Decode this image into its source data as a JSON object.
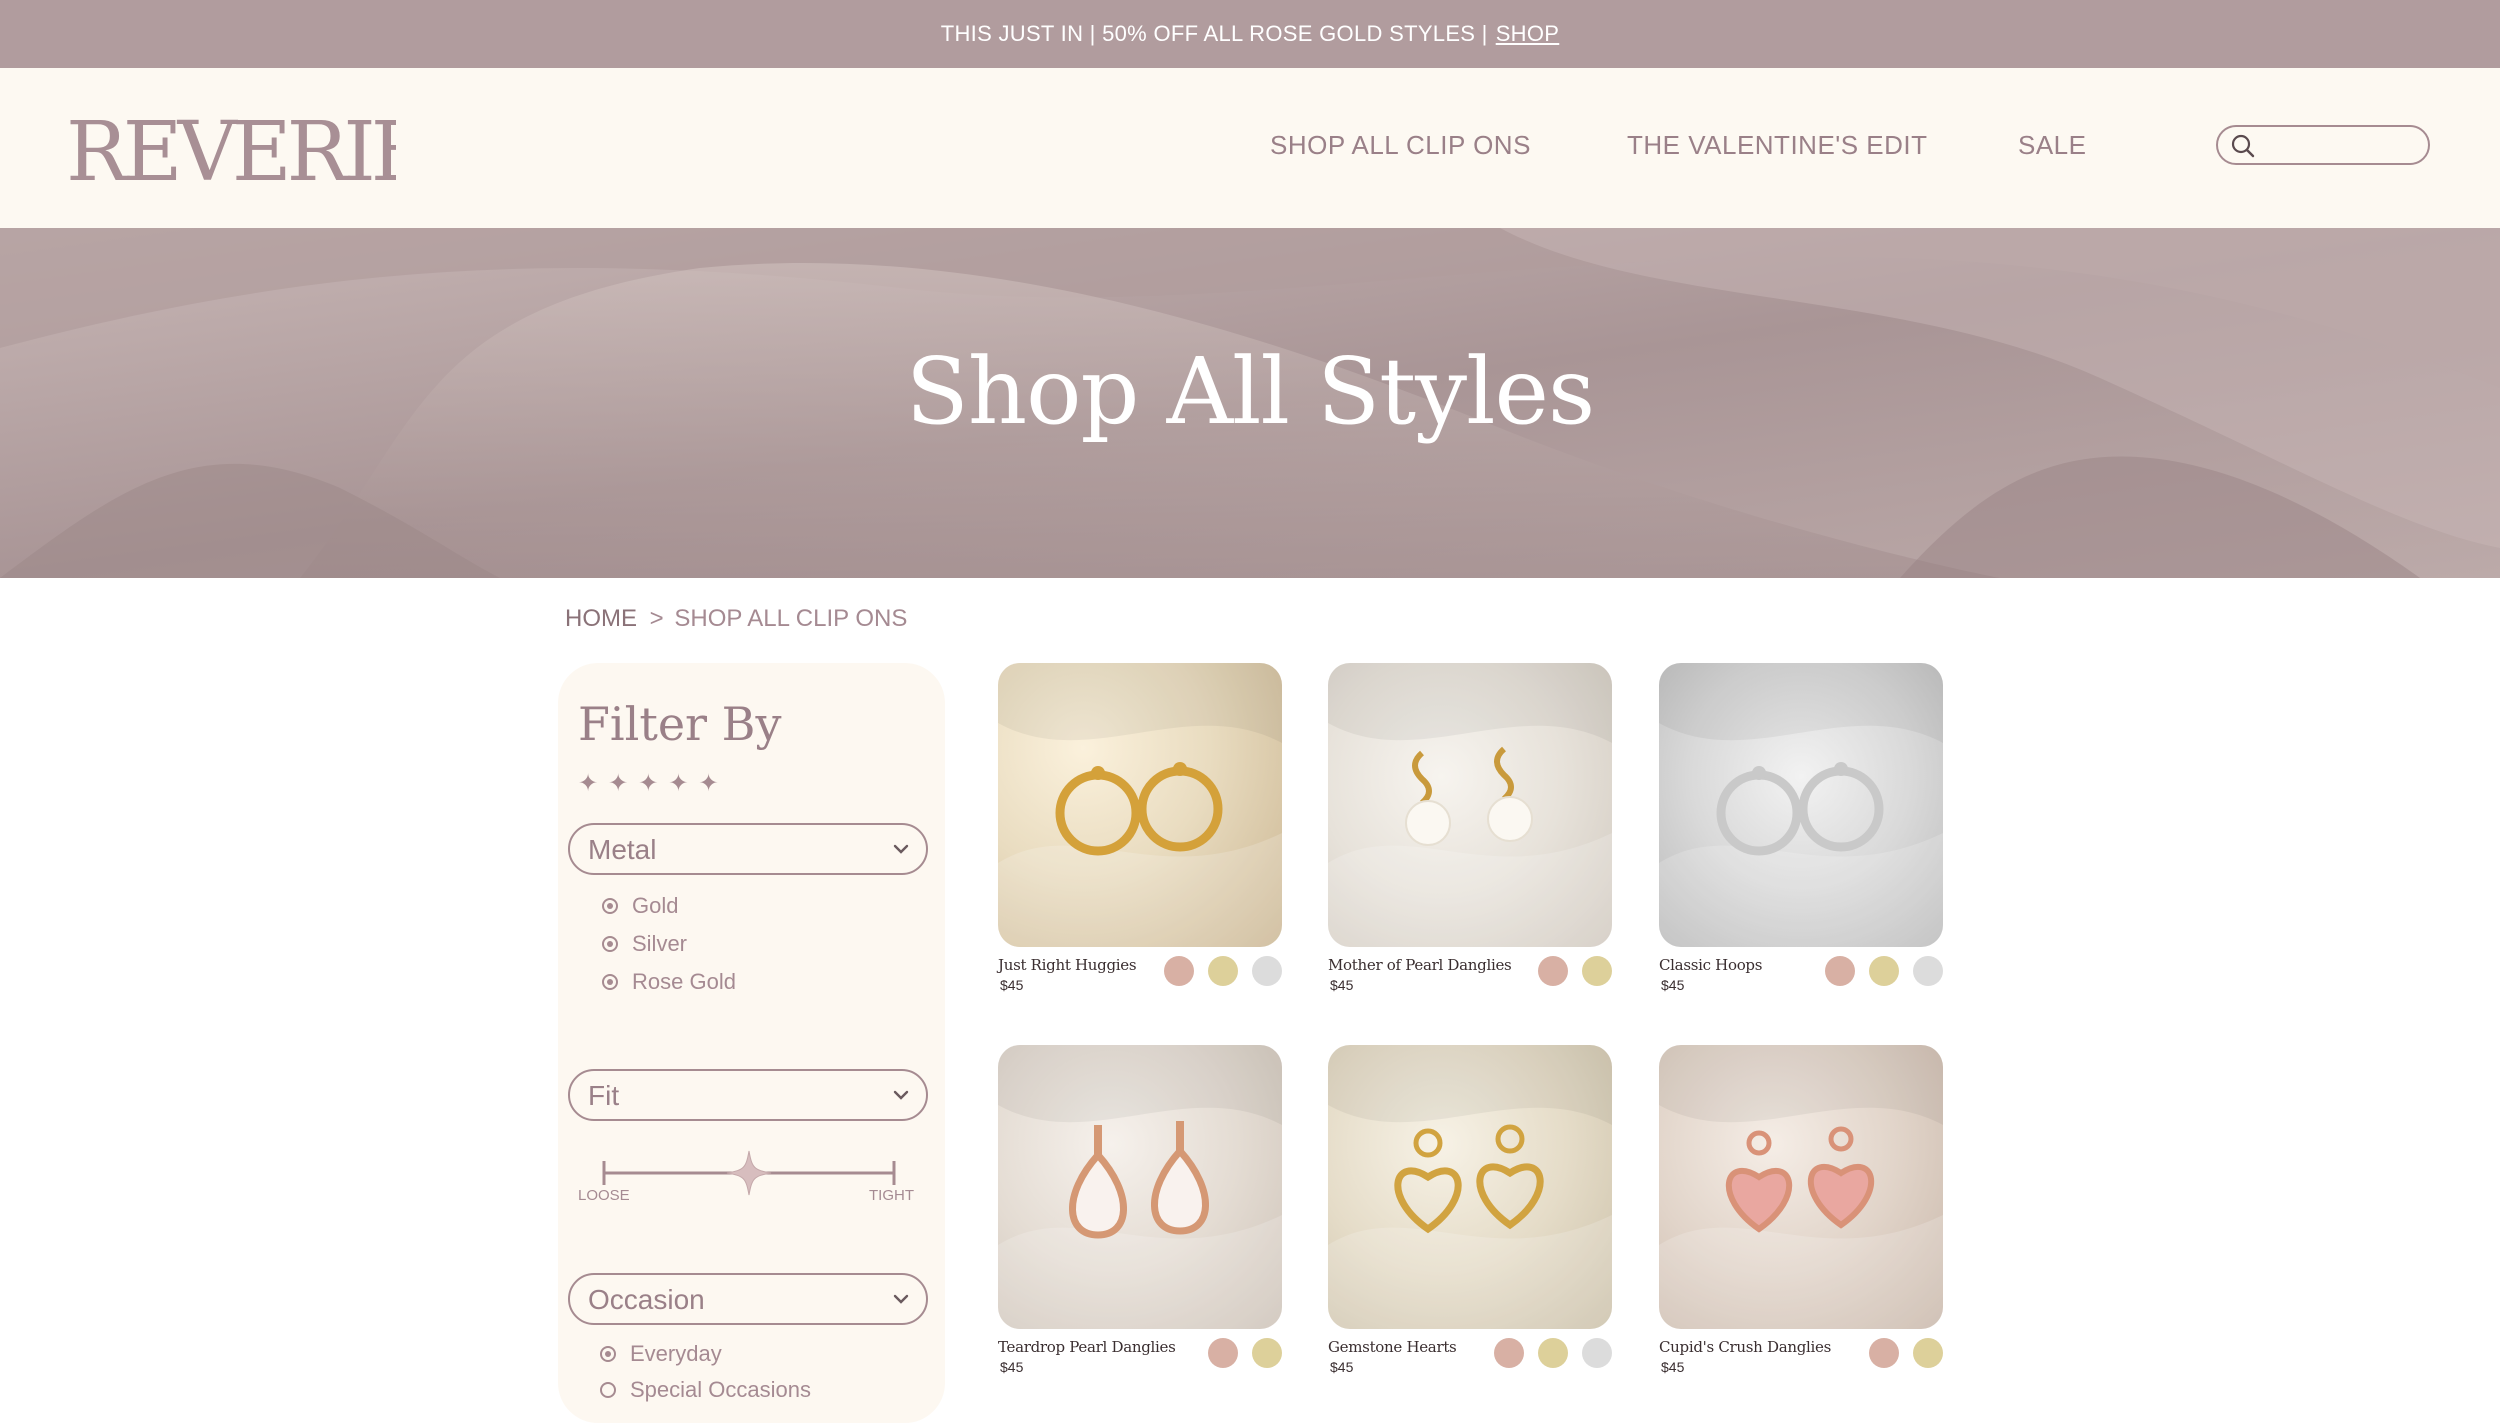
{
  "announcement": {
    "text": "THIS JUST IN | 50% OFF ALL ROSE GOLD STYLES |",
    "link": "SHOP"
  },
  "header": {
    "logo": "REVERIE",
    "nav": [
      "SHOP ALL CLIP ONS",
      "THE VALENTINE'S EDIT",
      "SALE"
    ],
    "search_placeholder": ""
  },
  "hero": {
    "title": "Shop All Styles"
  },
  "breadcrumb": {
    "home": "HOME",
    "separator": ">",
    "current": "SHOP ALL CLIP ONS"
  },
  "filters": {
    "title": "Filter By",
    "stars": "✦✦✦✦✦",
    "metal": {
      "label": "Metal",
      "options": [
        "Gold",
        "Silver",
        "Rose Gold"
      ]
    },
    "fit": {
      "label": "Fit",
      "min_label": "LOOSE",
      "max_label": "TIGHT",
      "value": 0.5
    },
    "occasion": {
      "label": "Occasion",
      "options": [
        "Everyday",
        "Special Occasions"
      ]
    }
  },
  "colors": {
    "rose": "#d8b0a4",
    "gold": "#ddd09a",
    "silver": "#dcdcdc",
    "accent": "#a68b91"
  },
  "products": [
    {
      "name": "Just Right Huggies",
      "price": "$45",
      "swatches": [
        "rose",
        "gold",
        "silver"
      ]
    },
    {
      "name": "Mother of Pearl Danglies",
      "price": "$45",
      "swatches": [
        "rose",
        "gold"
      ]
    },
    {
      "name": "Classic Hoops",
      "price": "$45",
      "swatches": [
        "rose",
        "gold",
        "silver"
      ]
    },
    {
      "name": "Teardrop Pearl Danglies",
      "price": "$45",
      "swatches": [
        "rose",
        "gold"
      ]
    },
    {
      "name": "Gemstone Hearts",
      "price": "$45",
      "swatches": [
        "rose",
        "gold",
        "silver"
      ]
    },
    {
      "name": "Cupid's Crush Danglies",
      "price": "$45",
      "swatches": [
        "rose",
        "gold"
      ]
    }
  ]
}
